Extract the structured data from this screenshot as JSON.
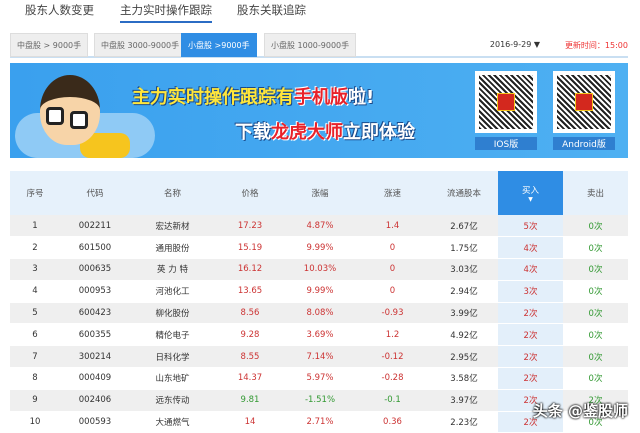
{
  "top_tabs": [
    "股东人数变更",
    "主力实时操作跟踪",
    "股东关联追踪"
  ],
  "sub_tabs": [
    "中盘股 > 9000手",
    "中盘股 3000-9000手",
    "小盘股 >9000手",
    "小盘股 1000-9000手"
  ],
  "date": "2016-9-29 ▼",
  "update_time": "更新时间：15:00",
  "banner": {
    "line1_a": "主力实时操作跟踪有",
    "line1_b": "手机版",
    "line1_c": "啦!",
    "line2_a": "下载",
    "line2_b": "龙虎大师",
    "line2_c": "立即体验",
    "qr_ios": "IOS版",
    "qr_android": "Android版"
  },
  "table": {
    "headers": [
      "序号",
      "代码",
      "名称",
      "价格",
      "涨幅",
      "涨速",
      "流通股本",
      "买入",
      "卖出"
    ],
    "sort_indicator": "▼",
    "rows": [
      [
        "1",
        "002211",
        "宏达新材",
        "17.23",
        "4.87%",
        "1.4",
        "2.67亿",
        "5次",
        "0次"
      ],
      [
        "2",
        "601500",
        "通用股份",
        "15.19",
        "9.99%",
        "0",
        "1.75亿",
        "4次",
        "0次"
      ],
      [
        "3",
        "000635",
        "英 力 特",
        "16.12",
        "10.03%",
        "0",
        "3.03亿",
        "4次",
        "0次"
      ],
      [
        "4",
        "000953",
        "河池化工",
        "13.65",
        "9.99%",
        "0",
        "2.94亿",
        "3次",
        "0次"
      ],
      [
        "5",
        "600423",
        "柳化股份",
        "8.56",
        "8.08%",
        "-0.93",
        "3.99亿",
        "2次",
        "0次"
      ],
      [
        "6",
        "600355",
        "精伦电子",
        "9.28",
        "3.69%",
        "1.2",
        "4.92亿",
        "2次",
        "0次"
      ],
      [
        "7",
        "300214",
        "日科化学",
        "8.55",
        "7.14%",
        "-0.12",
        "2.95亿",
        "2次",
        "0次"
      ],
      [
        "8",
        "000409",
        "山东地矿",
        "14.37",
        "5.97%",
        "-0.28",
        "3.58亿",
        "2次",
        "0次"
      ],
      [
        "9",
        "002406",
        "远东传动",
        "9.81",
        "-1.51%",
        "-0.1",
        "3.97亿",
        "2次",
        "2次"
      ],
      [
        "10",
        "000593",
        "大通燃气",
        "14",
        "2.71%",
        "0.36",
        "2.23亿",
        "2次",
        "0次"
      ]
    ],
    "row_colors": [
      "r",
      "r",
      "r",
      "r",
      "r",
      "r",
      "r",
      "r",
      "g",
      "r"
    ]
  },
  "watermark": "头条 @鉴股师"
}
